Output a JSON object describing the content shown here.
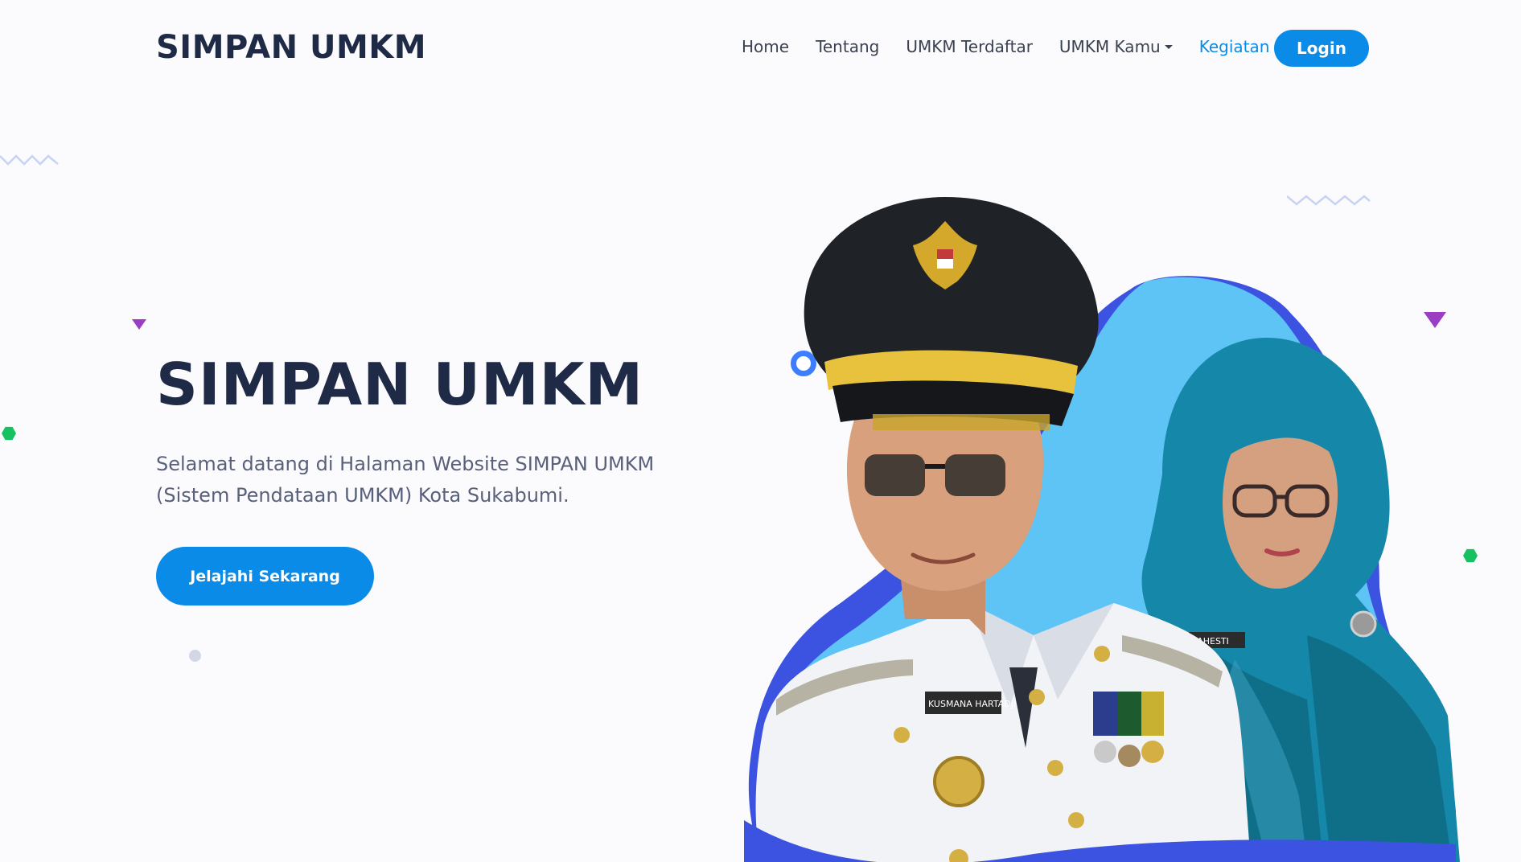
{
  "header": {
    "brand": "SIMPAN UMKM",
    "nav": [
      {
        "label": "Home"
      },
      {
        "label": "Tentang"
      },
      {
        "label": "UMKM Terdaftar"
      },
      {
        "label": "UMKM Kamu"
      },
      {
        "label": "Kegiatan"
      }
    ],
    "login_label": "Login"
  },
  "hero": {
    "title": "SIMPAN UMKM",
    "description": "Selamat datang di Halaman Website SIMPAN UMKM (Sistem Pendataan UMKM) Kota Sukabumi.",
    "cta_label": "Jelajahi Sekarang"
  },
  "portrait": {
    "name_tag_left": "KUSMANA HARTADJI",
    "name_tag_right": "RAHESTI"
  },
  "colors": {
    "accent": "#0a8be8",
    "heading": "#1f2a47",
    "blob_dark": "#3c52e0",
    "blob_light": "#5ec3f5"
  }
}
